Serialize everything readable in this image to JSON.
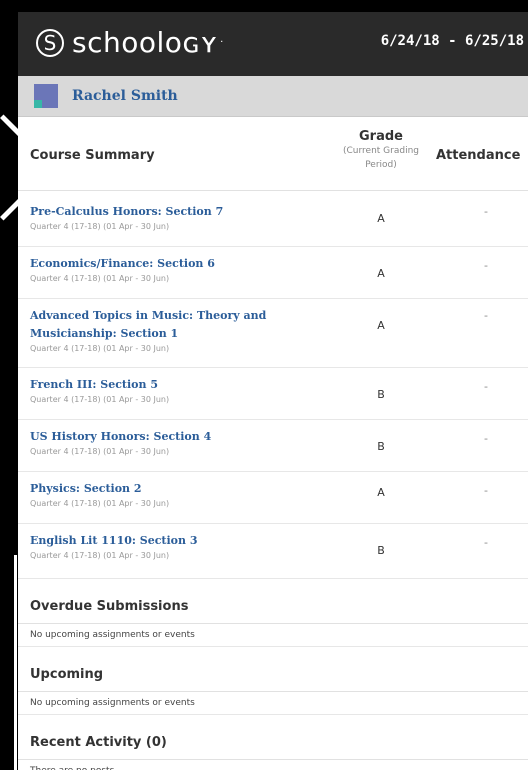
{
  "header": {
    "logo_letter": "S",
    "logo_text": "schoolᴏɢʏ",
    "logo_mark": "·",
    "date_range": "6/24/18 - 6/25/18"
  },
  "user": {
    "name": "Rachel Smith"
  },
  "summary": {
    "title": "Course Summary",
    "grade_title": "Grade",
    "grade_sub": "(Current Grading Period)",
    "attendance_title": "Attendance"
  },
  "courses": [
    {
      "name": "Pre-Calculus Honors: Section 7",
      "term": "Quarter 4 (17-18) (01 Apr - 30 Jun)",
      "grade": "A",
      "attendance": "-"
    },
    {
      "name": "Economics/Finance: Section 6",
      "term": "Quarter 4 (17-18) (01 Apr - 30 Jun)",
      "grade": "A",
      "attendance": "-"
    },
    {
      "name": "Advanced Topics in Music: Theory and Musicianship: Section 1",
      "term": "Quarter 4 (17-18) (01 Apr - 30 Jun)",
      "grade": "A",
      "attendance": "-"
    },
    {
      "name": "French III: Section 5",
      "term": "Quarter 4 (17-18) (01 Apr - 30 Jun)",
      "grade": "B",
      "attendance": "-"
    },
    {
      "name": "US History Honors: Section 4",
      "term": "Quarter 4 (17-18) (01 Apr - 30 Jun)",
      "grade": "B",
      "attendance": "-"
    },
    {
      "name": "Physics: Section 2",
      "term": "Quarter 4 (17-18) (01 Apr - 30 Jun)",
      "grade": "A",
      "attendance": "-"
    },
    {
      "name": "English Lit 1110: Section 3",
      "term": "Quarter 4 (17-18) (01 Apr - 30 Jun)",
      "grade": "B",
      "attendance": "-"
    }
  ],
  "overdue": {
    "title": "Overdue Submissions",
    "text": "No upcoming assignments or events"
  },
  "upcoming": {
    "title": "Upcoming",
    "text": "No upcoming assignments or events"
  },
  "recent": {
    "title": "Recent Activity (0)",
    "text": "There are no posts"
  }
}
